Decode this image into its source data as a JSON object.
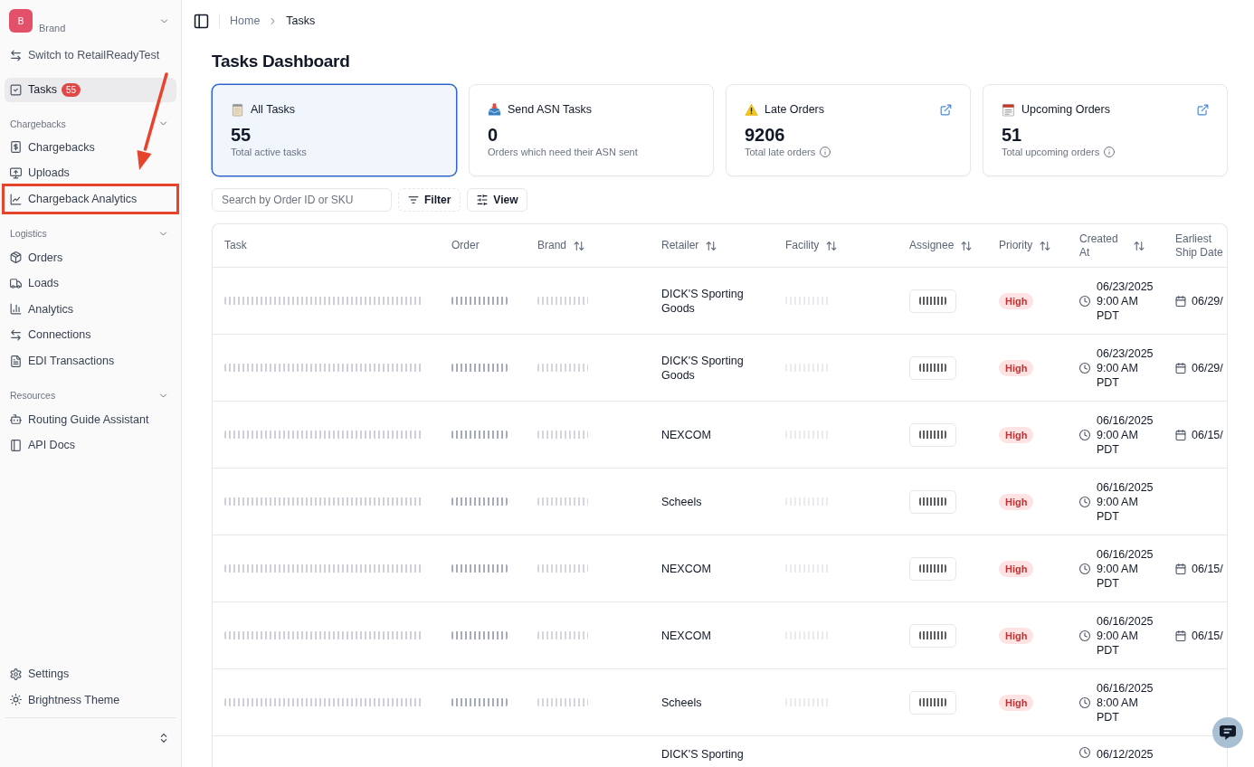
{
  "sidebar": {
    "workspace": {
      "initial": "B",
      "name": "Brand"
    },
    "switch_link": "Switch to RetailReadyTest",
    "items": [
      {
        "label": "Tasks",
        "badge": "55",
        "selected": true,
        "highlighted": false
      }
    ],
    "groups": [
      {
        "title": "Chargebacks",
        "expanded": true,
        "items": [
          {
            "label": "Chargebacks",
            "selected": false,
            "highlighted": false
          },
          {
            "label": "Uploads",
            "selected": false,
            "highlighted": false
          },
          {
            "label": "Chargeback Analytics",
            "selected": false,
            "highlighted": true
          }
        ]
      },
      {
        "title": "Logistics",
        "expanded": true,
        "items": [
          {
            "label": "Orders",
            "selected": false,
            "highlighted": false
          },
          {
            "label": "Loads",
            "selected": false,
            "highlighted": false
          },
          {
            "label": "Analytics",
            "selected": false,
            "highlighted": false
          },
          {
            "label": "Connections",
            "selected": false,
            "highlighted": false
          },
          {
            "label": "EDI Transactions",
            "selected": false,
            "highlighted": false
          }
        ]
      },
      {
        "title": "Resources",
        "expanded": true,
        "items": [
          {
            "label": "Routing Guide Assistant",
            "selected": false,
            "highlighted": false
          },
          {
            "label": "API Docs",
            "selected": false,
            "highlighted": false
          }
        ]
      }
    ],
    "footer_items": [
      {
        "label": "Settings",
        "selected": false,
        "highlighted": false
      },
      {
        "label": "Brightness Theme",
        "selected": false,
        "highlighted": false
      }
    ]
  },
  "breadcrumb": [
    {
      "label": "Home",
      "current": false
    },
    {
      "label": "Tasks",
      "current": true
    }
  ],
  "page_title": "Tasks Dashboard",
  "cards": [
    {
      "title": "All Tasks",
      "value": "55",
      "caption": "Total active tasks",
      "selected": true,
      "external_link": false,
      "info": false
    },
    {
      "title": "Send ASN Tasks",
      "value": "0",
      "caption": "Orders which need their ASN sent",
      "selected": false,
      "external_link": false,
      "info": false
    },
    {
      "title": "Late Orders",
      "value": "9206",
      "caption": "Total late orders",
      "selected": false,
      "external_link": true,
      "info": true
    },
    {
      "title": "Upcoming Orders",
      "value": "51",
      "caption": "Total upcoming orders",
      "selected": false,
      "external_link": true,
      "info": true
    }
  ],
  "toolbar": {
    "search": {
      "placeholder": "Search by Order ID or SKU"
    },
    "buttons": [
      {
        "label": "Filter",
        "kind": "filter"
      },
      {
        "label": "View",
        "kind": "view"
      }
    ]
  },
  "table": {
    "columns": [
      {
        "label": "Task",
        "sortable": false
      },
      {
        "label": "Order",
        "sortable": false
      },
      {
        "label": "Brand",
        "sortable": true
      },
      {
        "label": "Retailer",
        "sortable": true
      },
      {
        "label": "Facility",
        "sortable": true
      },
      {
        "label": "Assignee",
        "sortable": true
      },
      {
        "label": "Priority",
        "sortable": true
      },
      {
        "label": "Created At",
        "sortable": true
      },
      {
        "label": "Earliest Ship Date",
        "sortable": false
      }
    ],
    "rows": [
      {
        "redacted": true,
        "retailer": "DICK'S Sporting Goods",
        "priority": "High",
        "created_at": "06/23/2025 9:00 AM PDT",
        "ship_date": "06/29/"
      },
      {
        "redacted": true,
        "retailer": "DICK'S Sporting Goods",
        "priority": "High",
        "created_at": "06/23/2025 9:00 AM PDT",
        "ship_date": "06/29/"
      },
      {
        "redacted": true,
        "retailer": "NEXCOM",
        "priority": "High",
        "created_at": "06/16/2025 9:00 AM PDT",
        "ship_date": "06/15/"
      },
      {
        "redacted": true,
        "retailer": "Scheels",
        "priority": "High",
        "created_at": "06/16/2025 9:00 AM PDT"
      },
      {
        "redacted": true,
        "retailer": "NEXCOM",
        "priority": "High",
        "created_at": "06/16/2025 9:00 AM PDT",
        "ship_date": "06/15/"
      },
      {
        "redacted": true,
        "retailer": "NEXCOM",
        "priority": "High",
        "created_at": "06/16/2025 9:00 AM PDT",
        "ship_date": "06/15/"
      },
      {
        "redacted": true,
        "retailer": "Scheels",
        "priority": "High",
        "created_at": "06/16/2025 8:00 AM PDT"
      },
      {
        "retailer": "DICK'S Sporting",
        "created_at": "06/12/2025"
      }
    ]
  }
}
